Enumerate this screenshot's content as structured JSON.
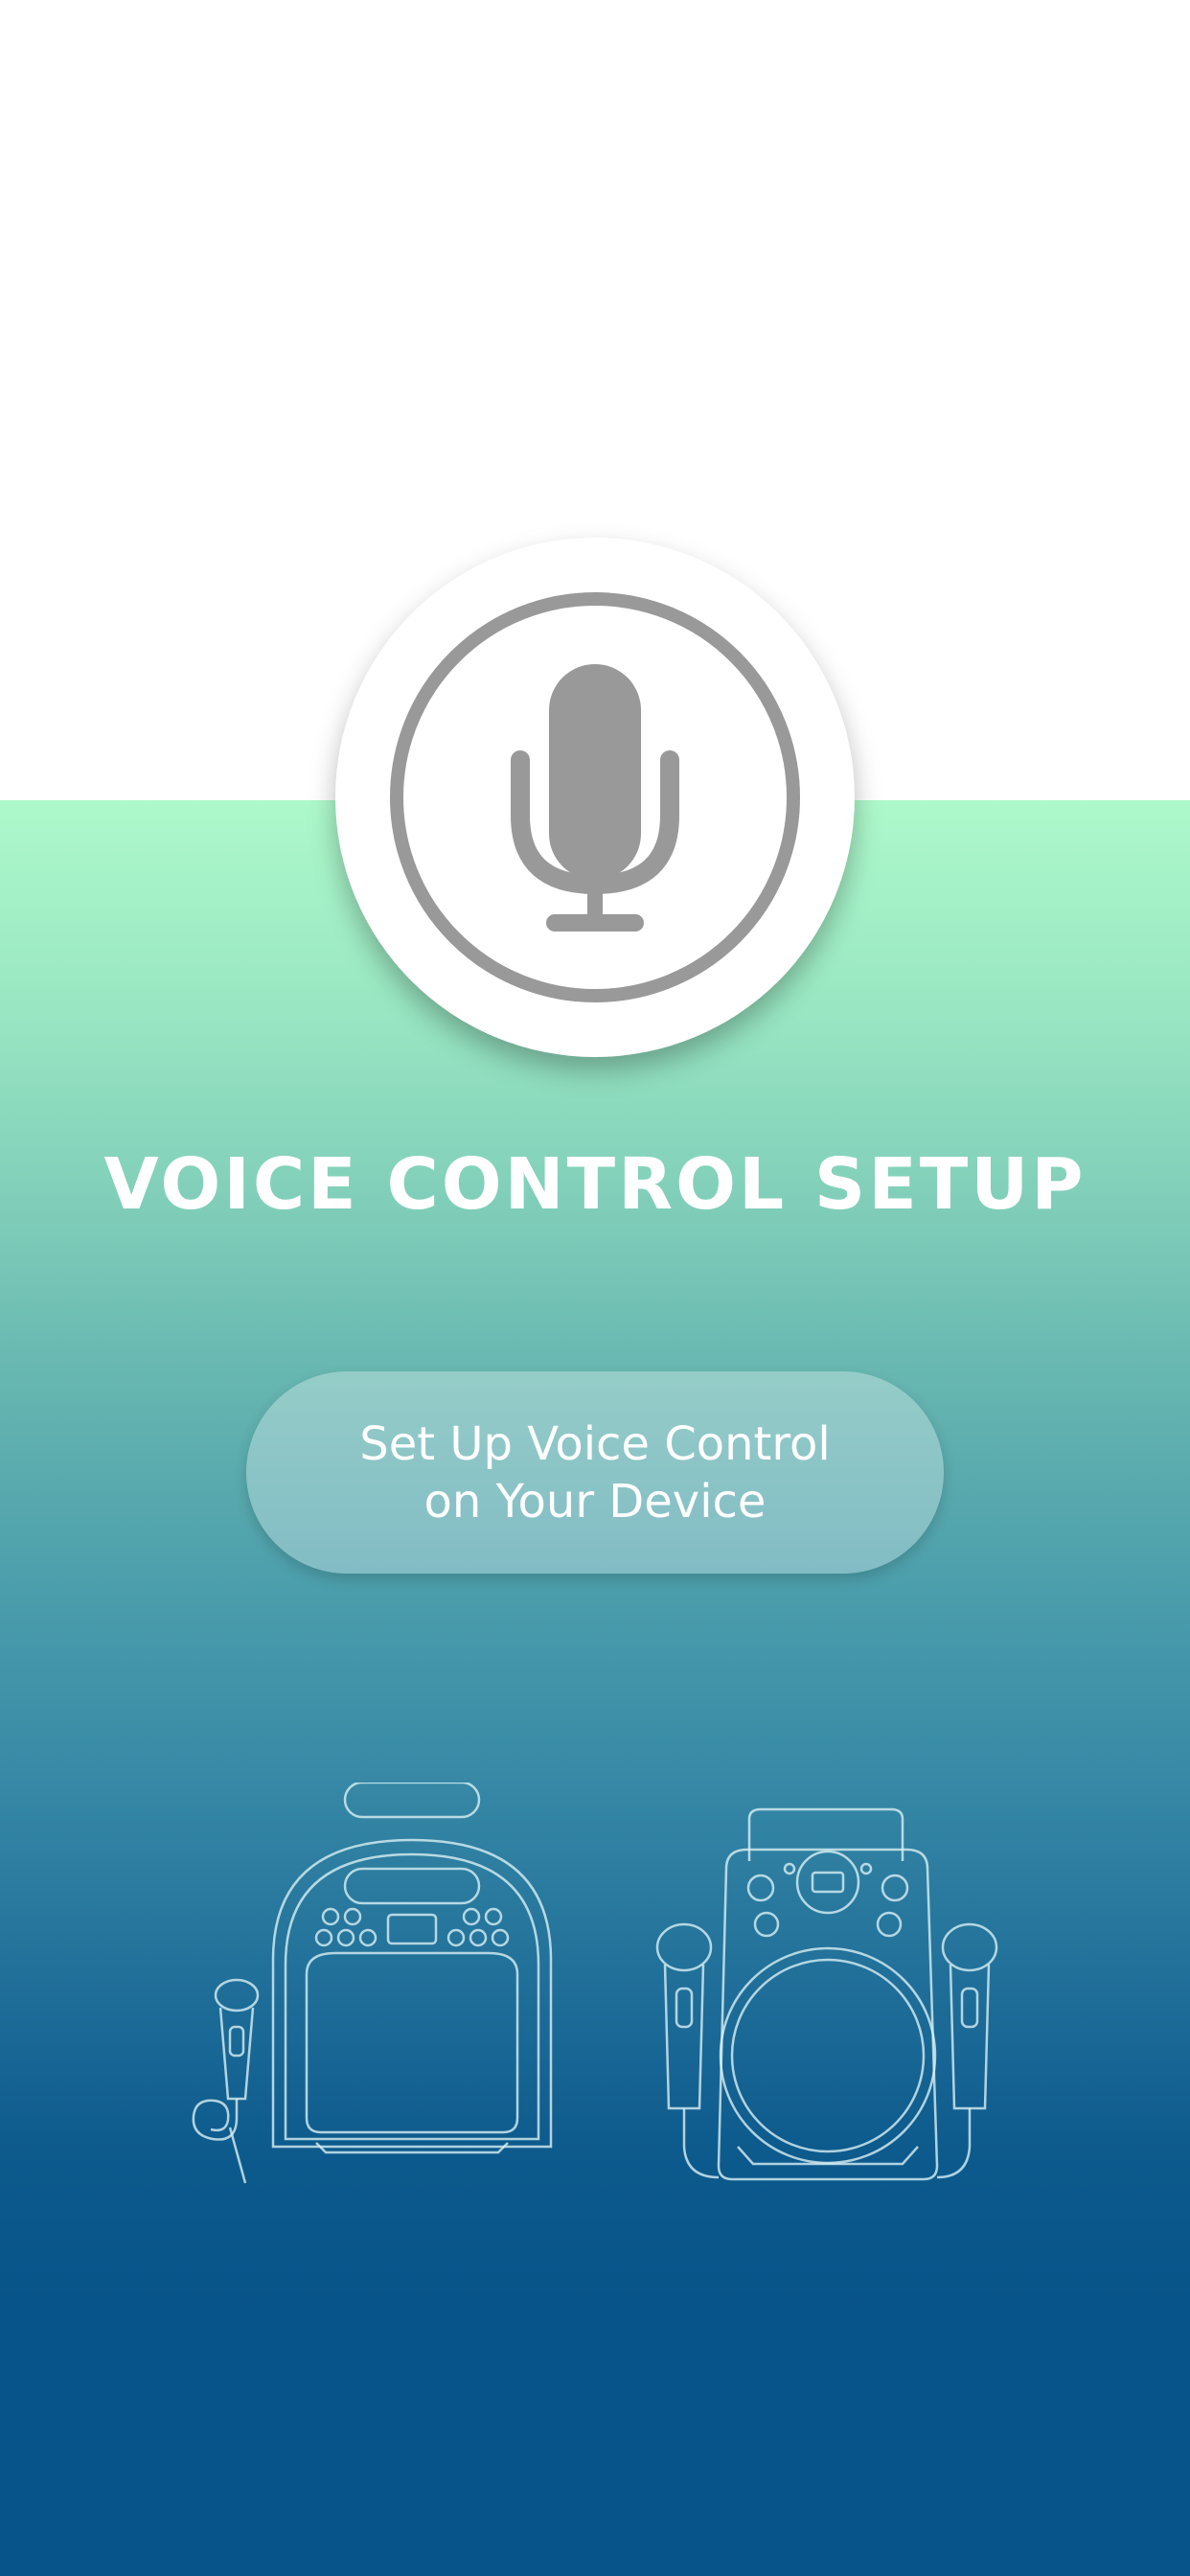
{
  "screen": {
    "title": "VOICE CONTROL SETUP",
    "setup_button": {
      "line1": "Set Up Voice Control",
      "line2": "on Your Device"
    }
  },
  "icons": {
    "hero": "microphone-icon",
    "illustrations": [
      "karaoke-speaker-with-microphone-illustration",
      "karaoke-machine-with-two-microphones-illustration"
    ]
  },
  "colors": {
    "gradient_top": "#aef9cb",
    "gradient_bottom": "#06548a",
    "icon_gray": "#999999",
    "text": "#ffffff"
  }
}
